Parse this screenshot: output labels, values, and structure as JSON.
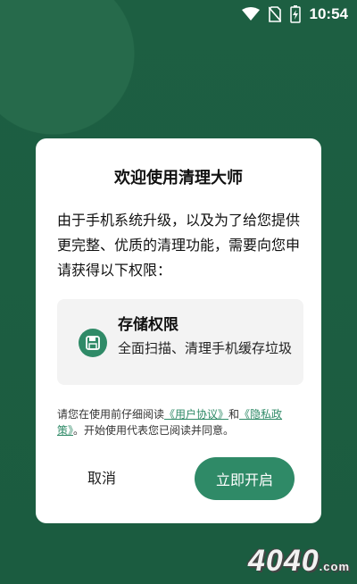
{
  "status_bar": {
    "time": "10:54",
    "icons": [
      "wifi-icon",
      "no-sim-icon",
      "battery-charging-icon"
    ]
  },
  "dialog": {
    "title": "欢迎使用清理大师",
    "description": "由于手机系统升级，以及为了给您提供更完整、优质的清理功能，需要向您申请获得以下权限：",
    "permission": {
      "icon": "floppy-disk-icon",
      "title": "存储权限",
      "description": "全面扫描、清理手机缓存垃圾"
    },
    "notice": {
      "prefix": "请您在使用前仔细阅读",
      "user_agreement": "《用户协议》",
      "and": "和",
      "privacy_policy": "《隐私政策》",
      "suffix": "。开始使用代表您已阅读并同意。"
    },
    "cancel_label": "取消",
    "confirm_label": "立即开启"
  },
  "colors": {
    "background": "#1d5f42",
    "accent": "#2f8a67",
    "card": "#f3f3f3"
  },
  "watermark": {
    "text": "4040",
    "suffix": ".com"
  }
}
